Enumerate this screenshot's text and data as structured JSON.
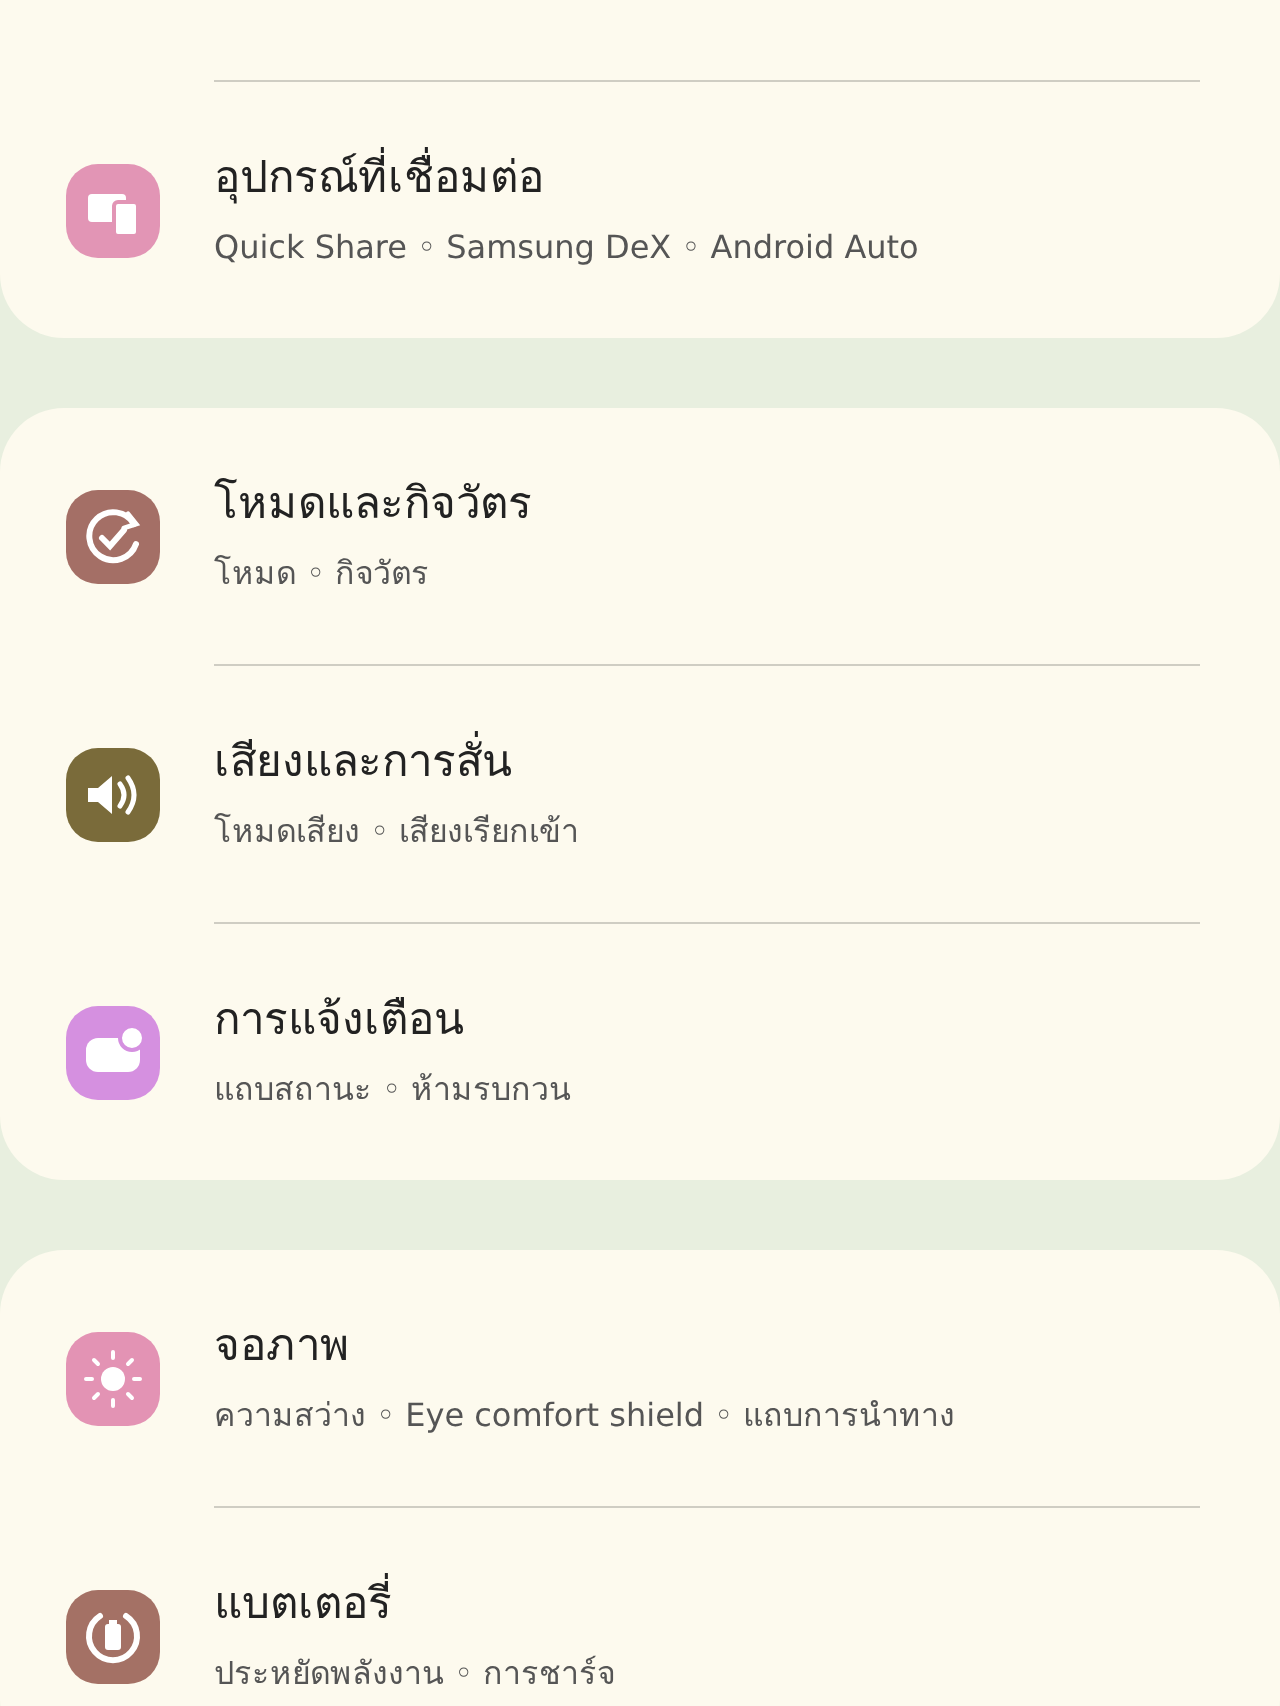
{
  "groups": [
    {
      "items": [
        {
          "kind": "devices",
          "title": "อุปกรณ์ที่เชื่อมต่อ",
          "subtitle": "Quick Share ◦ Samsung DeX ◦ Android Auto",
          "color": "#e295b5"
        }
      ]
    },
    {
      "items": [
        {
          "kind": "modes",
          "title": "โหมดและกิจวัตร",
          "subtitle": "โหมด ◦ กิจวัตร",
          "color": "#a46f66"
        },
        {
          "kind": "sound",
          "title": "เสียงและการสั่น",
          "subtitle": "โหมดเสียง ◦ เสียงเรียกเข้า",
          "color": "#7a6b3a"
        },
        {
          "kind": "notifications",
          "title": "การแจ้งเตือน",
          "subtitle": "แถบสถานะ ◦ ห้ามรบกวน",
          "color": "#d590e0"
        }
      ]
    },
    {
      "items": [
        {
          "kind": "display",
          "title": "จอภาพ",
          "subtitle": "ความสว่าง ◦ Eye comfort shield ◦ แถบการนำทาง",
          "color": "#e393b4"
        },
        {
          "kind": "battery",
          "title": "แบตเตอรี่",
          "subtitle": "ประหยัดพลังงาน ◦ การชาร์จ",
          "color": "#a47165"
        }
      ]
    }
  ]
}
